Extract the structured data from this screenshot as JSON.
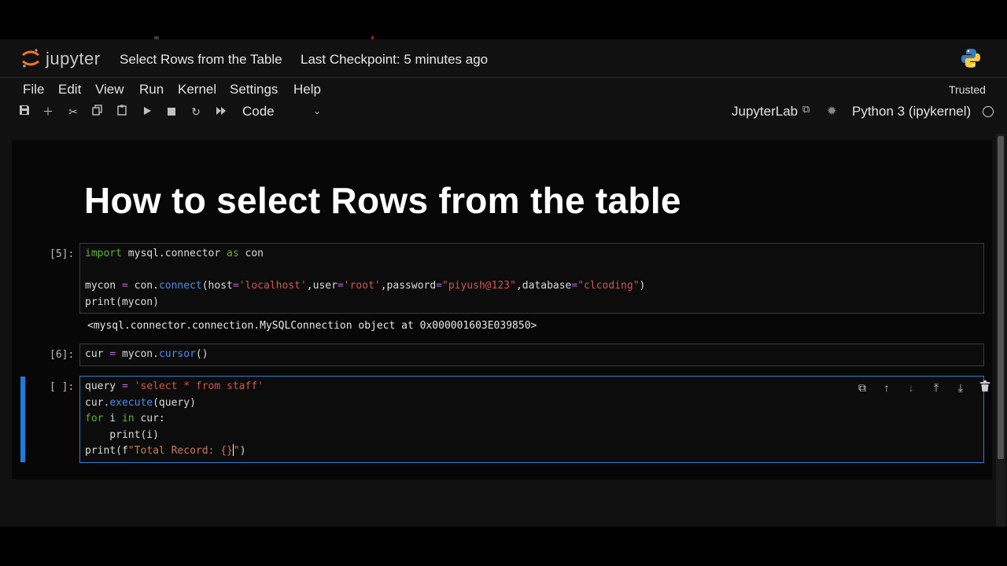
{
  "app": {
    "brand": "jupyter",
    "notebook_title": "Select Rows from the Table",
    "checkpoint": "Last Checkpoint: 5 minutes ago",
    "trusted": "Trusted"
  },
  "menu": [
    "File",
    "Edit",
    "View",
    "Run",
    "Kernel",
    "Settings",
    "Help"
  ],
  "toolbar": {
    "cell_type": "Code",
    "jupyterlab_label": "JupyterLab",
    "kernel_label": "Python 3 (ipykernel)",
    "icons": [
      "save-icon",
      "plus-icon",
      "scissors-icon",
      "copy-icon",
      "paste-icon",
      "run-icon",
      "stop-icon",
      "restart-icon",
      "fast-forward-icon"
    ]
  },
  "notebook": {
    "heading": "How to select Rows from the table",
    "cells": [
      {
        "prompt": "[5]:",
        "code_lines": [
          "import mysql.connector as con",
          "",
          "mycon = con.connect(host='localhost',user='root',password=\"piyush@123\",database=\"clcoding\")",
          "print(mycon)"
        ],
        "output": "<mysql.connector.connection.MySQLConnection object at 0x000001603E039850>"
      },
      {
        "prompt": "[6]:",
        "code_lines": [
          "cur = mycon.cursor()"
        ]
      },
      {
        "prompt": "[ ]:",
        "code_lines": [
          "query = 'select * from staff'",
          "cur.execute(query)",
          "for i in cur:",
          "    print(i)",
          "print(f\"Total Record: {}\")"
        ]
      }
    ]
  }
}
